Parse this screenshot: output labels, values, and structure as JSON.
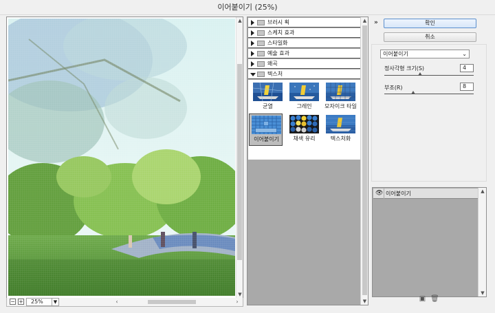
{
  "window": {
    "title": "이어붙이기 (25%)"
  },
  "preview": {
    "zoom_value": "25%",
    "zoom_out_symbol": "−",
    "zoom_in_symbol": "+"
  },
  "gallery": {
    "categories": [
      {
        "label": "브러시 획",
        "expanded": false
      },
      {
        "label": "스케치 효과",
        "expanded": false
      },
      {
        "label": "스타일화",
        "expanded": false
      },
      {
        "label": "예술 효과",
        "expanded": false
      },
      {
        "label": "왜곡",
        "expanded": false
      },
      {
        "label": "텍스처",
        "expanded": true
      }
    ],
    "texture_filters": [
      {
        "label": "균열",
        "selected": false
      },
      {
        "label": "그레인",
        "selected": false
      },
      {
        "label": "모자이크 타일",
        "selected": false
      },
      {
        "label": "이어붙이기",
        "selected": true
      },
      {
        "label": "채색 유리",
        "selected": false
      },
      {
        "label": "텍스처화",
        "selected": false
      }
    ]
  },
  "buttons": {
    "ok_label": "확인",
    "cancel_label": "취소"
  },
  "settings": {
    "filter_selected": "이어붙이기",
    "params": [
      {
        "label": "정사각형 크기(S)",
        "value": "4",
        "fraction": 0.4
      },
      {
        "label": "부조(R)",
        "value": "8",
        "fraction": 0.32
      }
    ]
  },
  "layers": [
    {
      "name": "이어붙이기",
      "visible": true
    }
  ],
  "colors": {
    "accent": "#5c8fcd",
    "panel_bg": "#a9a9a9",
    "sky": "#dff4f4",
    "grass": "#4c8e2e"
  }
}
